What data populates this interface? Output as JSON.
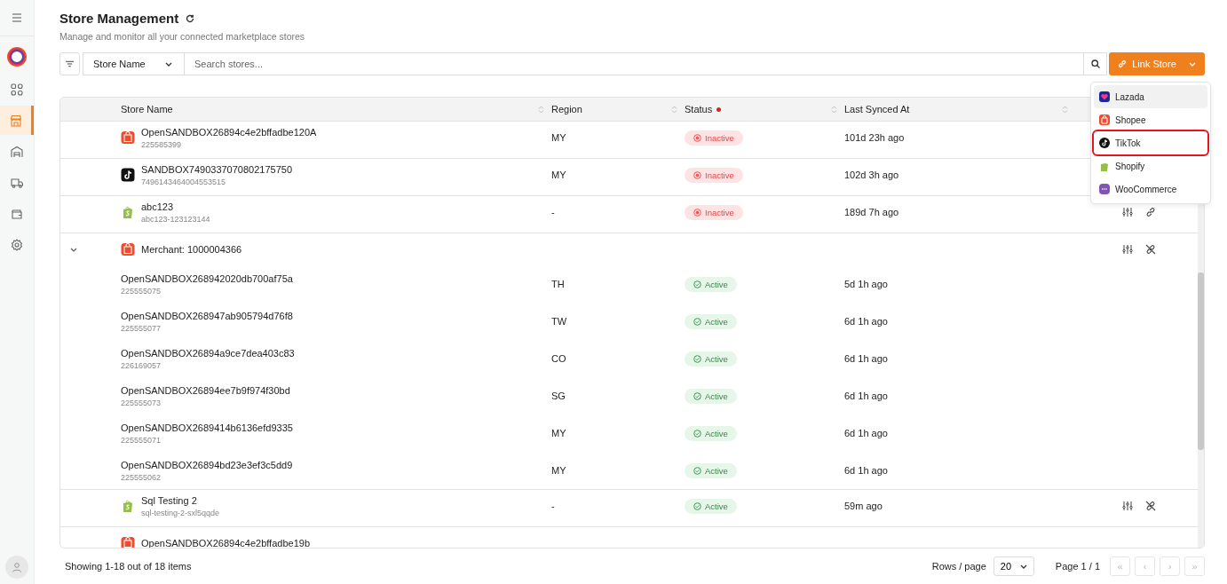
{
  "sidebar": {
    "items": [
      {
        "selected": false
      },
      {
        "selected": true
      },
      {
        "selected": false
      },
      {
        "selected": false
      },
      {
        "selected": false
      },
      {
        "selected": false
      }
    ]
  },
  "header": {
    "title": "Store Management",
    "subtitle": "Manage and monitor all your connected marketplace stores"
  },
  "toolbar": {
    "field_select": "Store Name",
    "search": {
      "placeholder": "Search stores..."
    },
    "link_button": "Link Store"
  },
  "link_menu": {
    "items": [
      {
        "label": "Lazada",
        "kind": "lazada",
        "selected": true,
        "highlighted": false
      },
      {
        "label": "Shopee",
        "kind": "shopee",
        "selected": false,
        "highlighted": false
      },
      {
        "label": "TikTok",
        "kind": "tiktok",
        "selected": false,
        "highlighted": true
      },
      {
        "label": "Shopify",
        "kind": "shopify",
        "selected": false,
        "highlighted": false
      },
      {
        "label": "WooCommerce",
        "kind": "woocommerce",
        "selected": false,
        "highlighted": false
      }
    ]
  },
  "table": {
    "columns": [
      {
        "label": "Store Name",
        "filtered": false
      },
      {
        "label": "Region",
        "filtered": false
      },
      {
        "label": "Status",
        "filtered": true
      },
      {
        "label": "Last Synced At",
        "filtered": false
      }
    ],
    "rows": [
      {
        "kind": "shopee",
        "name": "OpenSANDBOX26894c4e2bffadbe120A",
        "id": "225585399",
        "region": "MY",
        "active": false,
        "status_label": "Inactive",
        "synced": "101d 23h ago"
      },
      {
        "kind": "tiktok",
        "name": "SANDBOX7490337070802175750",
        "id": "7496143464004553515",
        "region": "MY",
        "active": false,
        "status_label": "Inactive",
        "synced": "102d 3h ago"
      },
      {
        "kind": "shopify",
        "name": "abc123",
        "id": "abc123-123123144",
        "region": "-",
        "active": false,
        "status_label": "Inactive",
        "synced": "189d 7h ago",
        "linked": false
      },
      {
        "kind": "group",
        "merchant": {
          "kind": "shopee",
          "name": "Merchant: 1000004366"
        },
        "expanded": true,
        "linked": true,
        "children": [
          {
            "name": "OpenSANDBOX268942020db700af75a",
            "id": "225555075",
            "region": "TH",
            "active": true,
            "status_label": "Active",
            "synced": "5d 1h ago"
          },
          {
            "name": "OpenSANDBOX268947ab905794d76f8",
            "id": "225555077",
            "region": "TW",
            "active": true,
            "status_label": "Active",
            "synced": "6d 1h ago"
          },
          {
            "name": "OpenSANDBOX26894a9ce7dea403c83",
            "id": "226169057",
            "region": "CO",
            "active": true,
            "status_label": "Active",
            "synced": "6d 1h ago"
          },
          {
            "name": "OpenSANDBOX26894ee7b9f974f30bd",
            "id": "225555073",
            "region": "SG",
            "active": true,
            "status_label": "Active",
            "synced": "6d 1h ago"
          },
          {
            "name": "OpenSANDBOX2689414b6136efd9335",
            "id": "225555071",
            "region": "MY",
            "active": true,
            "status_label": "Active",
            "synced": "6d 1h ago"
          },
          {
            "name": "OpenSANDBOX26894bd23e3ef3c5dd9",
            "id": "225555062",
            "region": "MY",
            "active": true,
            "status_label": "Active",
            "synced": "6d 1h ago"
          }
        ]
      },
      {
        "kind": "shopify",
        "name": "Sql Testing 2",
        "id": "sql-testing-2-sxl5qqde",
        "region": "-",
        "active": true,
        "status_label": "Active",
        "synced": "59m ago",
        "linked": true
      },
      {
        "kind": "shopee",
        "name": "OpenSANDBOX26894c4e2bffadbe19b"
      }
    ]
  },
  "footer": {
    "summary": "Showing 1-18 out of 18 items",
    "rows_per_page_label": "Rows / page",
    "rows_per_page": "20",
    "page": "Page 1 / 1",
    "pager_buttons": [
      {
        "symbol": "«",
        "disabled": true
      },
      {
        "symbol": "‹",
        "disabled": true
      },
      {
        "symbol": "›",
        "disabled": true
      },
      {
        "symbol": "»",
        "disabled": true
      }
    ]
  }
}
